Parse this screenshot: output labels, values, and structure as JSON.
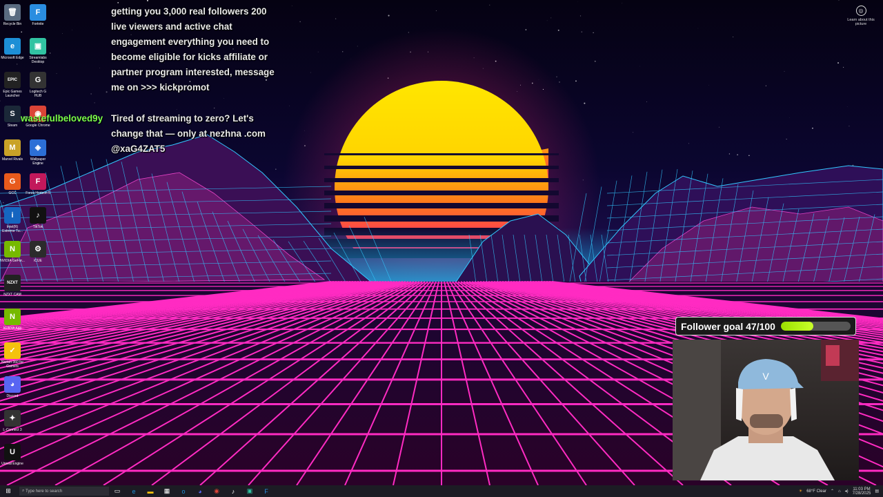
{
  "desktop_icons": [
    {
      "label": "Recycle Bin",
      "glyph": "🗑",
      "color": "#5a6b80",
      "col": 0,
      "row": 0
    },
    {
      "label": "Fortnite",
      "glyph": "F",
      "color": "#2a8de0",
      "col": 1,
      "row": 0
    },
    {
      "label": "Microsoft Edge",
      "glyph": "e",
      "color": "#1d8fd6",
      "col": 0,
      "row": 1
    },
    {
      "label": "Streamlabs Desktop",
      "glyph": "▣",
      "color": "#31c3a2",
      "col": 1,
      "row": 1
    },
    {
      "label": "Epic Games Launcher",
      "glyph": "EPIC",
      "color": "#222",
      "col": 0,
      "row": 2
    },
    {
      "label": "Logitech G HUB",
      "glyph": "G",
      "color": "#333",
      "col": 1,
      "row": 2
    },
    {
      "label": "Steam",
      "glyph": "S",
      "color": "#1b2838",
      "col": 0,
      "row": 3
    },
    {
      "label": "Google Chrome",
      "glyph": "◉",
      "color": "#db4437",
      "col": 1,
      "row": 3
    },
    {
      "label": "Marvel Rivals",
      "glyph": "M",
      "color": "#c9a227",
      "col": 0,
      "row": 4
    },
    {
      "label": "Wallpaper Engine",
      "glyph": "◈",
      "color": "#2c6fd6",
      "col": 1,
      "row": 4
    },
    {
      "label": "GCC",
      "glyph": "G",
      "color": "#e85a1c",
      "col": 0,
      "row": 5
    },
    {
      "label": "Forza Horizon 5",
      "glyph": "F",
      "color": "#c2185b",
      "col": 1,
      "row": 5
    },
    {
      "label": "Intel(R) Extreme Tu...",
      "glyph": "i",
      "color": "#1565c0",
      "col": 0,
      "row": 6
    },
    {
      "label": "TikTok",
      "glyph": "♪",
      "color": "#111",
      "col": 1,
      "row": 6
    },
    {
      "label": "NVIDIA GeFor...",
      "glyph": "N",
      "color": "#76b900",
      "col": 0,
      "row": 7
    },
    {
      "label": "iCUE",
      "glyph": "⚙",
      "color": "#2b2b2b",
      "col": 1,
      "row": 7
    },
    {
      "label": "NZXT CAM",
      "glyph": "NZXT",
      "color": "#222",
      "col": 0,
      "row": 8
    },
    {
      "label": "NVIDIA App",
      "glyph": "N",
      "color": "#76b900",
      "col": 0,
      "row": 9
    },
    {
      "label": "Norton 360 for Gamers",
      "glyph": "✓",
      "color": "#f4c20d",
      "col": 0,
      "row": 10
    },
    {
      "label": "Discord",
      "glyph": "◕",
      "color": "#5865f2",
      "col": 0,
      "row": 11
    },
    {
      "label": "L-Connect 3",
      "glyph": "✦",
      "color": "#333",
      "col": 0,
      "row": 12
    },
    {
      "label": "Unreal Engine",
      "glyph": "U",
      "color": "#111",
      "col": 0,
      "row": 13
    }
  ],
  "chat": {
    "username": "wastefulbeloved9y",
    "message1": "getting you 3,000 real followers 200 live viewers and active chat engagement everything you need to become eligible for kicks affiliate or partner program interested, message me on >>> kickpromot",
    "message2": "Tired of streaming to zero? Let's change that — only at nezhna .com @xaG4ZAT5"
  },
  "learn_about": {
    "label": "Learn about this picture"
  },
  "follower_goal": {
    "label": "Follower goal 47/100",
    "current": 47,
    "target": 100
  },
  "taskbar": {
    "search_placeholder": "Type here to search",
    "weather": "68°F Clear",
    "time": "11:03 PM",
    "date": "7/28/2025"
  },
  "colors": {
    "grid": "#ff2bc2",
    "mountain": "#32c8ff",
    "sun_top": "#ffe600",
    "sun_bottom": "#ff1e6e",
    "goal_fill": "#b4f000"
  }
}
